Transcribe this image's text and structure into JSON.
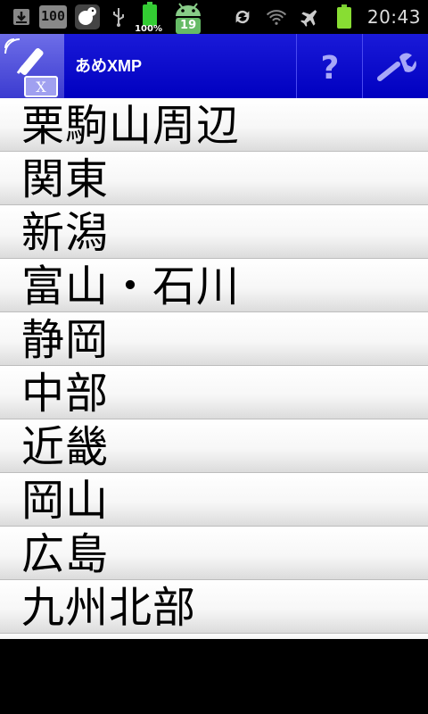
{
  "status_bar": {
    "icons": [
      "download-icon",
      "count-badge",
      "squirrel-app-icon",
      "usb-icon",
      "battery-widget-icon",
      "android-icon",
      "sync-icon",
      "wifi-icon",
      "airplane-icon",
      "battery-icon"
    ],
    "count_badge": "100",
    "battery_widget_percent": "100%",
    "android_badge": "19",
    "time": "20:43"
  },
  "title_bar": {
    "title": "あめXMP",
    "help_label": "?",
    "accent": "#0000c8"
  },
  "list": {
    "items": [
      "栗駒山周辺",
      "関東",
      "新潟",
      "富山・石川",
      "静岡",
      "中部",
      "近畿",
      "岡山",
      "広島",
      "九州北部"
    ]
  }
}
